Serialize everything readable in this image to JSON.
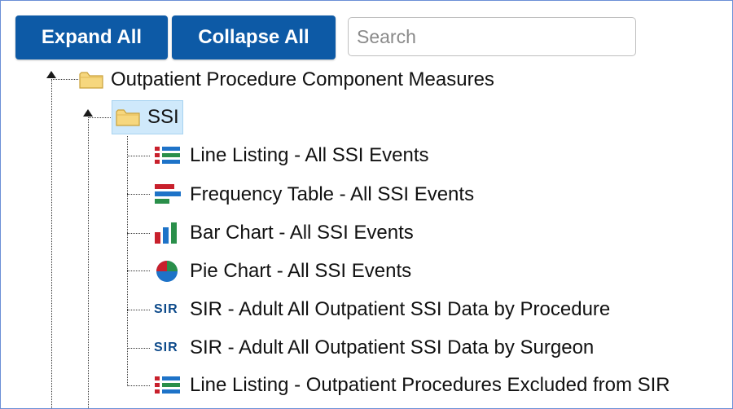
{
  "toolbar": {
    "expand_label": "Expand All",
    "collapse_label": "Collapse All",
    "search_placeholder": "Search"
  },
  "tree": {
    "root": {
      "label": "Outpatient Procedure Component Measures",
      "icon": "folder-icon"
    },
    "child": {
      "label": "SSI",
      "icon": "folder-icon",
      "selected": true
    },
    "items": [
      {
        "label": "Line Listing - All SSI Events",
        "icon": "line-listing-icon"
      },
      {
        "label": "Frequency Table - All SSI Events",
        "icon": "frequency-table-icon"
      },
      {
        "label": "Bar Chart - All SSI Events",
        "icon": "bar-chart-icon"
      },
      {
        "label": "Pie Chart - All SSI Events",
        "icon": "pie-chart-icon"
      },
      {
        "label": "SIR - Adult All Outpatient SSI Data by Procedure",
        "icon": "sir-icon",
        "icon_text": "SIR"
      },
      {
        "label": "SIR - Adult All Outpatient SSI Data by Surgeon",
        "icon": "sir-icon",
        "icon_text": "SIR"
      },
      {
        "label": "Line Listing - Outpatient Procedures Excluded from SIR",
        "icon": "line-listing-icon"
      }
    ]
  },
  "colors": {
    "button": "#0d5aa6",
    "selected_bg": "#cfe9fb",
    "sir_text": "#0d4a8a"
  }
}
